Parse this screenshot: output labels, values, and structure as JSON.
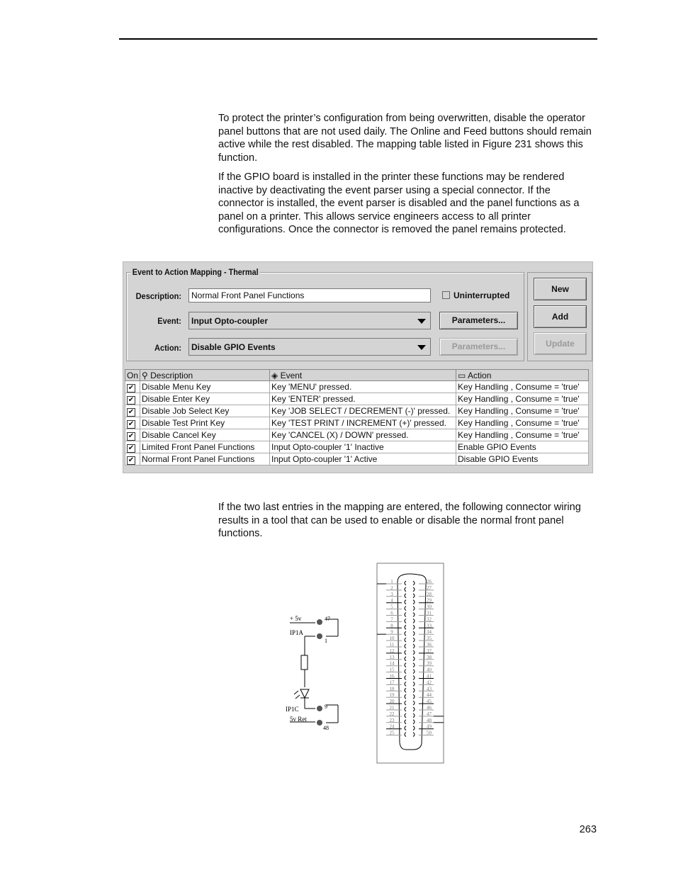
{
  "paragraphs": [
    "To protect the printer’s configuration from being overwritten, disable the operator panel buttons that are not used daily. The Online and Feed buttons should remain active while the rest disabled. The mapping table listed in Figure 231 shows this function.",
    "If the GPIO board is installed in the printer these functions may be rendered inactive by deactivating the event parser using a special connector. If the connector is installed, the event parser is disabled and the panel functions as a panel on a printer. This allows service engineers access to all printer configurations. Once the connector is removed the panel remains protected.",
    "If the two last entries in the mapping are entered, the following connector wiring results in a tool that can be used to enable or disable the normal front panel functions."
  ],
  "dialog": {
    "group_title": "Event to Action Mapping - Thermal",
    "description_label": "Description:",
    "description_value": "Normal Front Panel Functions",
    "uninterrupted_label": "Uninterrupted",
    "uninterrupted_checked": false,
    "event_label": "Event:",
    "event_value": "Input Opto-coupler",
    "action_label": "Action:",
    "action_value": "Disable GPIO Events",
    "parameters_label": "Parameters...",
    "new_label": "New",
    "add_label": "Add",
    "update_label": "Update"
  },
  "table": {
    "headers": [
      "On",
      "Description",
      "Event",
      "Action"
    ],
    "header_icons": [
      "",
      "tree-icon",
      "diamond-icon",
      "action-icon"
    ],
    "rows": [
      {
        "on": true,
        "description": "Disable Menu Key",
        "event": "Key 'MENU' pressed.",
        "action": "Key Handling , Consume = 'true'"
      },
      {
        "on": true,
        "description": "Disable Enter Key",
        "event": "Key 'ENTER' pressed.",
        "action": "Key Handling , Consume = 'true'"
      },
      {
        "on": true,
        "description": "Disable Job Select Key",
        "event": "Key 'JOB SELECT / DECREMENT (-)' pressed.",
        "action": "Key Handling , Consume = 'true'"
      },
      {
        "on": true,
        "description": "Disable Test Print Key",
        "event": "Key 'TEST PRINT / INCREMENT (+)' pressed.",
        "action": "Key Handling , Consume = 'true'"
      },
      {
        "on": true,
        "description": "Disable Cancel Key",
        "event": "Key 'CANCEL (X) / DOWN' pressed.",
        "action": "Key Handling , Consume = 'true'"
      },
      {
        "on": true,
        "description": "Limited Front Panel Functions",
        "event": "Input Opto-coupler '1' Inactive",
        "action": "Enable GPIO Events"
      },
      {
        "on": true,
        "description": "Normal Front Panel Functions",
        "event": "Input Opto-coupler '1' Active",
        "action": "Disable GPIO Events"
      }
    ]
  },
  "diagram": {
    "labels": {
      "plus5v": "+ 5v",
      "ip1a": "IP1A",
      "ip1c": "IP1C",
      "ret": "5v Ret"
    },
    "nodes": [
      "47",
      "1",
      "9",
      "48"
    ],
    "left_pins": [
      "1",
      "2",
      "3",
      "4",
      "5",
      "6",
      "7",
      "8",
      "9",
      "10",
      "11",
      "12",
      "13",
      "14",
      "15",
      "16",
      "17",
      "18",
      "19",
      "20",
      "21",
      "22",
      "23",
      "24",
      "25"
    ],
    "right_pins": [
      "26",
      "27",
      "28",
      "29",
      "30",
      "31",
      "32",
      "33",
      "34",
      "35",
      "36",
      "37",
      "38",
      "39",
      "40",
      "41",
      "42",
      "43",
      "44",
      "45",
      "46",
      "47",
      "48",
      "49",
      "50"
    ]
  },
  "page_number": "263"
}
